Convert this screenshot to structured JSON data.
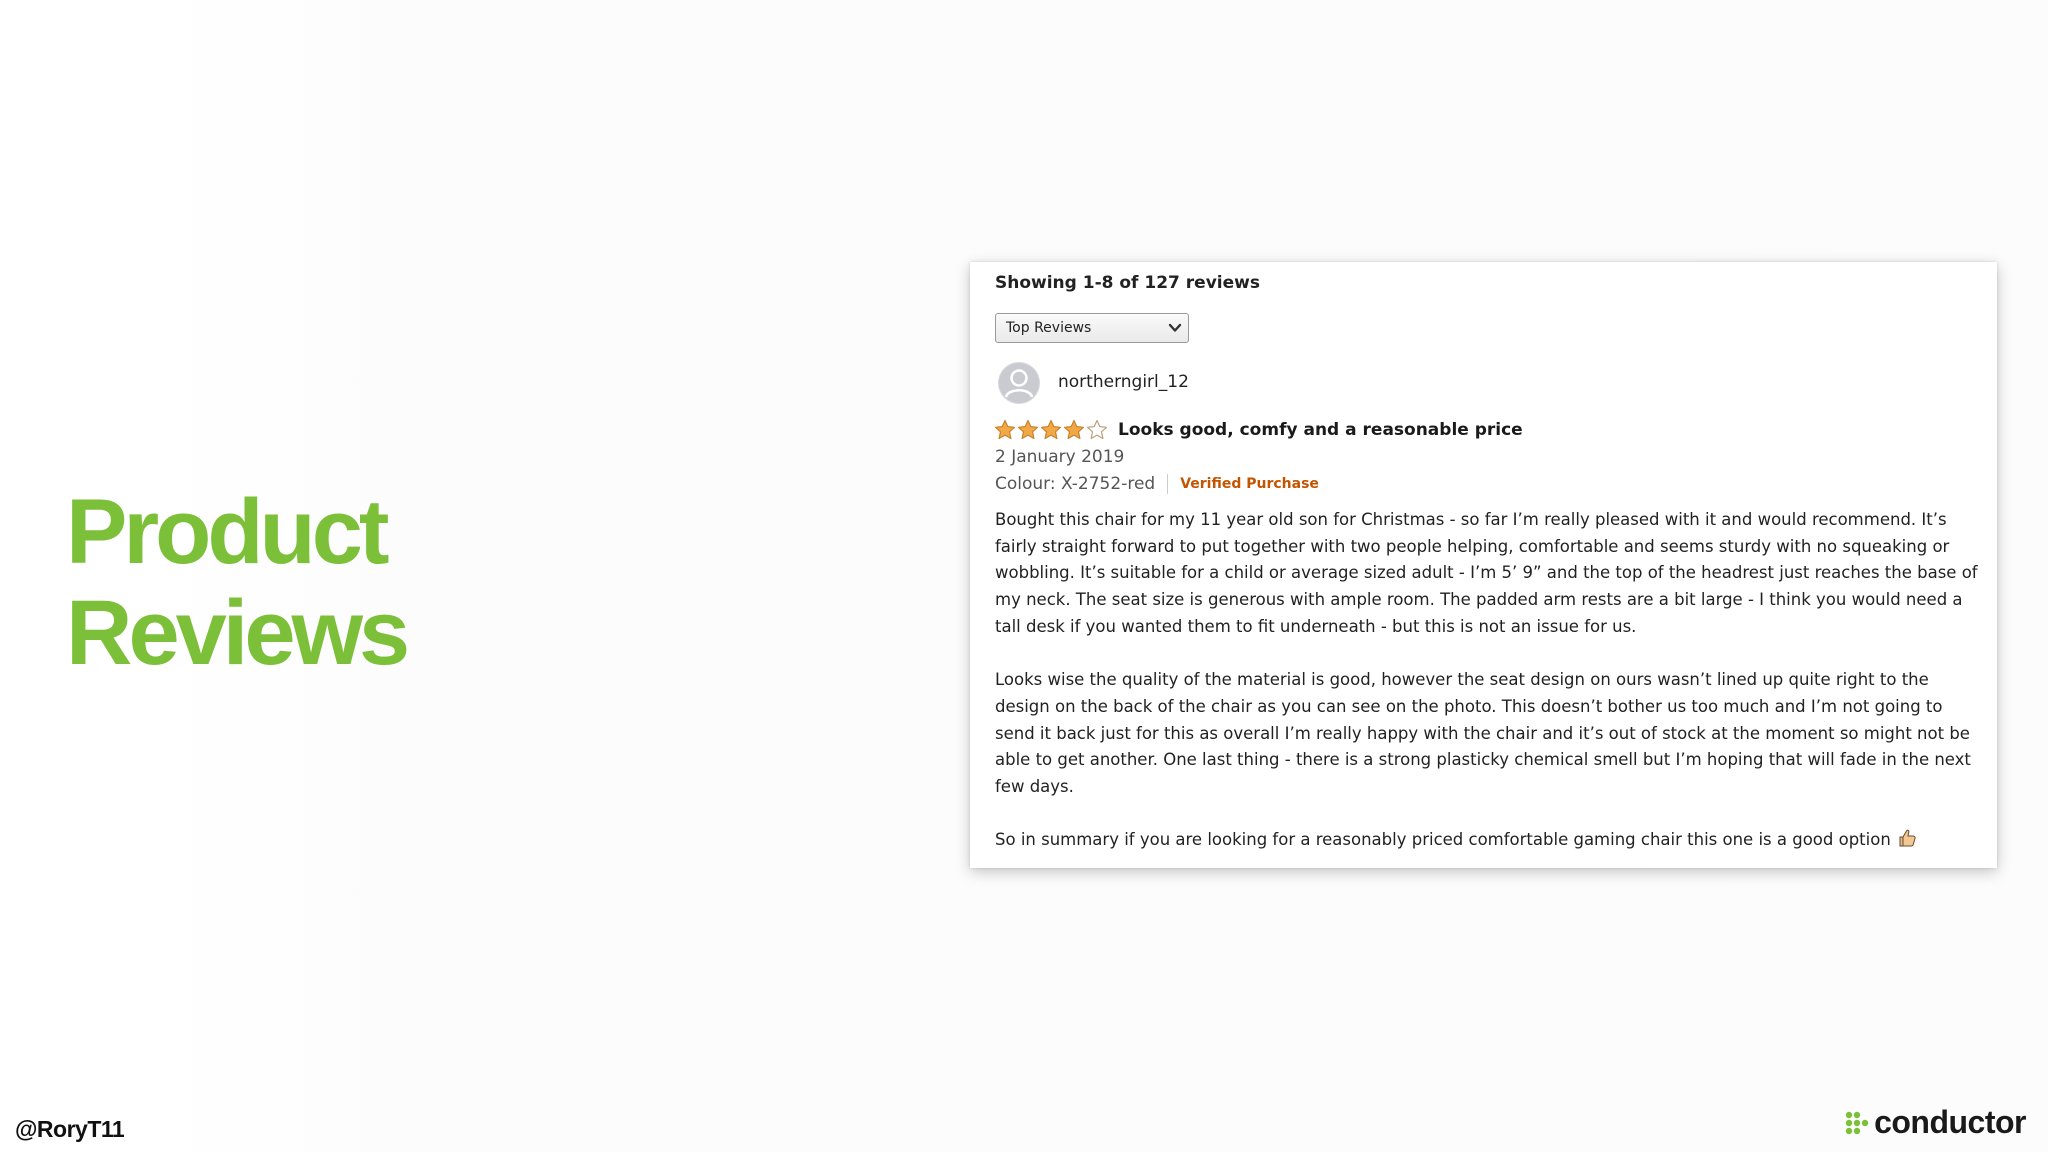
{
  "slide": {
    "title_line1": "Product",
    "title_line2": "Reviews",
    "title_color": "#7cc03a",
    "handle": "@RoryT11",
    "brand": "conductor",
    "brand_color": "#7cc03a"
  },
  "reviews": {
    "count_text": "Showing 1-8 of 127 reviews",
    "sort": {
      "selected": "Top Reviews",
      "icon": "chevron-down-icon"
    },
    "review": {
      "username": "northerngirl_12",
      "avatar_icon": "user-silhouette-icon",
      "rating": 4,
      "rating_max": 5,
      "star_color": "#f3a847",
      "title": "Looks good, comfy and a reasonable price",
      "date": "2 January 2019",
      "colour": "Colour: X-2752-red",
      "verified": "Verified Purchase",
      "verified_color": "#c45500",
      "paragraphs": [
        "Bought this chair for my 11 year old son for Christmas - so far I’m really pleased with it and would recommend. It’s fairly straight forward to put together with two people helping, comfortable and seems sturdy with no squeaking or wobbling. It’s suitable for a child or average sized adult - I’m 5’ 9” and the top of the headrest just reaches the base of my neck. The seat size is generous with ample room. The padded arm rests are a bit large - I think you would need a tall desk if you wanted them to fit underneath - but this is not an issue for us.",
        "Looks wise the quality of the material is good, however the seat design on ours wasn’t lined up quite right to the design on the back of the chair as you can see on the photo. This doesn’t bother us too much and I’m not going to send it back just for this as overall I’m really happy with the chair and it’s out of stock at the moment so might not be able to get another. One last thing - there is a strong plasticky chemical smell but I’m hoping that will fade in the next few days.",
        "So in summary if you are looking for a reasonably priced comfortable gaming chair this one is a good option"
      ],
      "end_icon": "thumbs-up-icon"
    }
  }
}
